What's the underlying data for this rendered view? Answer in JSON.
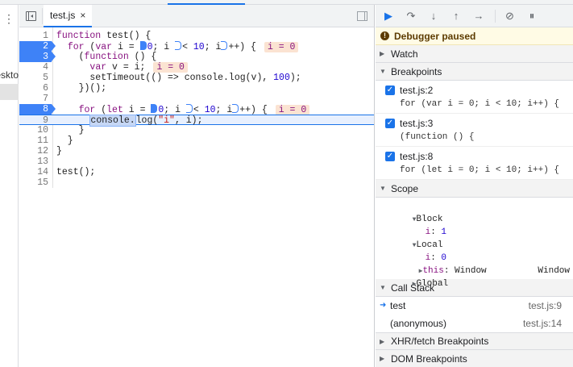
{
  "editor": {
    "tab_name": "test.js",
    "tab_close": "×",
    "lines": [
      {
        "num": "1"
      },
      {
        "num": "2"
      },
      {
        "num": "3"
      },
      {
        "num": "4"
      },
      {
        "num": "5"
      },
      {
        "num": "6"
      },
      {
        "num": "7"
      },
      {
        "num": "8"
      },
      {
        "num": "9"
      },
      {
        "num": "10"
      },
      {
        "num": "11"
      },
      {
        "num": "12"
      },
      {
        "num": "13"
      },
      {
        "num": "14"
      },
      {
        "num": "15"
      }
    ],
    "inline_values": {
      "line2": "i = 0",
      "line4": "i = 0",
      "line8": "i = 0"
    }
  },
  "left_edge": {
    "cut_text": "eskto"
  },
  "sidebar": {
    "paused_text": "Debugger paused",
    "watch_label": "Watch",
    "breakpoints_label": "Breakpoints",
    "breakpoints": [
      {
        "location": "test.js:2",
        "source": "for (var i = 0; i < 10; i++) {"
      },
      {
        "location": "test.js:3",
        "source": "(function () {"
      },
      {
        "location": "test.js:8",
        "source": "for (let i = 0; i < 10; i++) {"
      }
    ],
    "scope_label": "Scope",
    "scope": {
      "block_label": "Block",
      "block_var": "i",
      "block_val": "1",
      "local_label": "Local",
      "local_var": "i",
      "local_val": "0",
      "this_key": "this",
      "this_val": "Window",
      "global_label": "Global",
      "global_val": "Window"
    },
    "callstack_label": "Call Stack",
    "callstack": [
      {
        "name": "test",
        "file": "test.js:9"
      },
      {
        "name": "(anonymous)",
        "file": "test.js:14"
      }
    ],
    "xhr_label": "XHR/fetch Breakpoints",
    "dom_label": "DOM Breakpoints"
  },
  "colors": {
    "accent": "#1a73e8",
    "breakpoint": "#3e82f7",
    "paused_bg": "#fffbe5",
    "inline_value_bg": "#fbe3d2"
  }
}
